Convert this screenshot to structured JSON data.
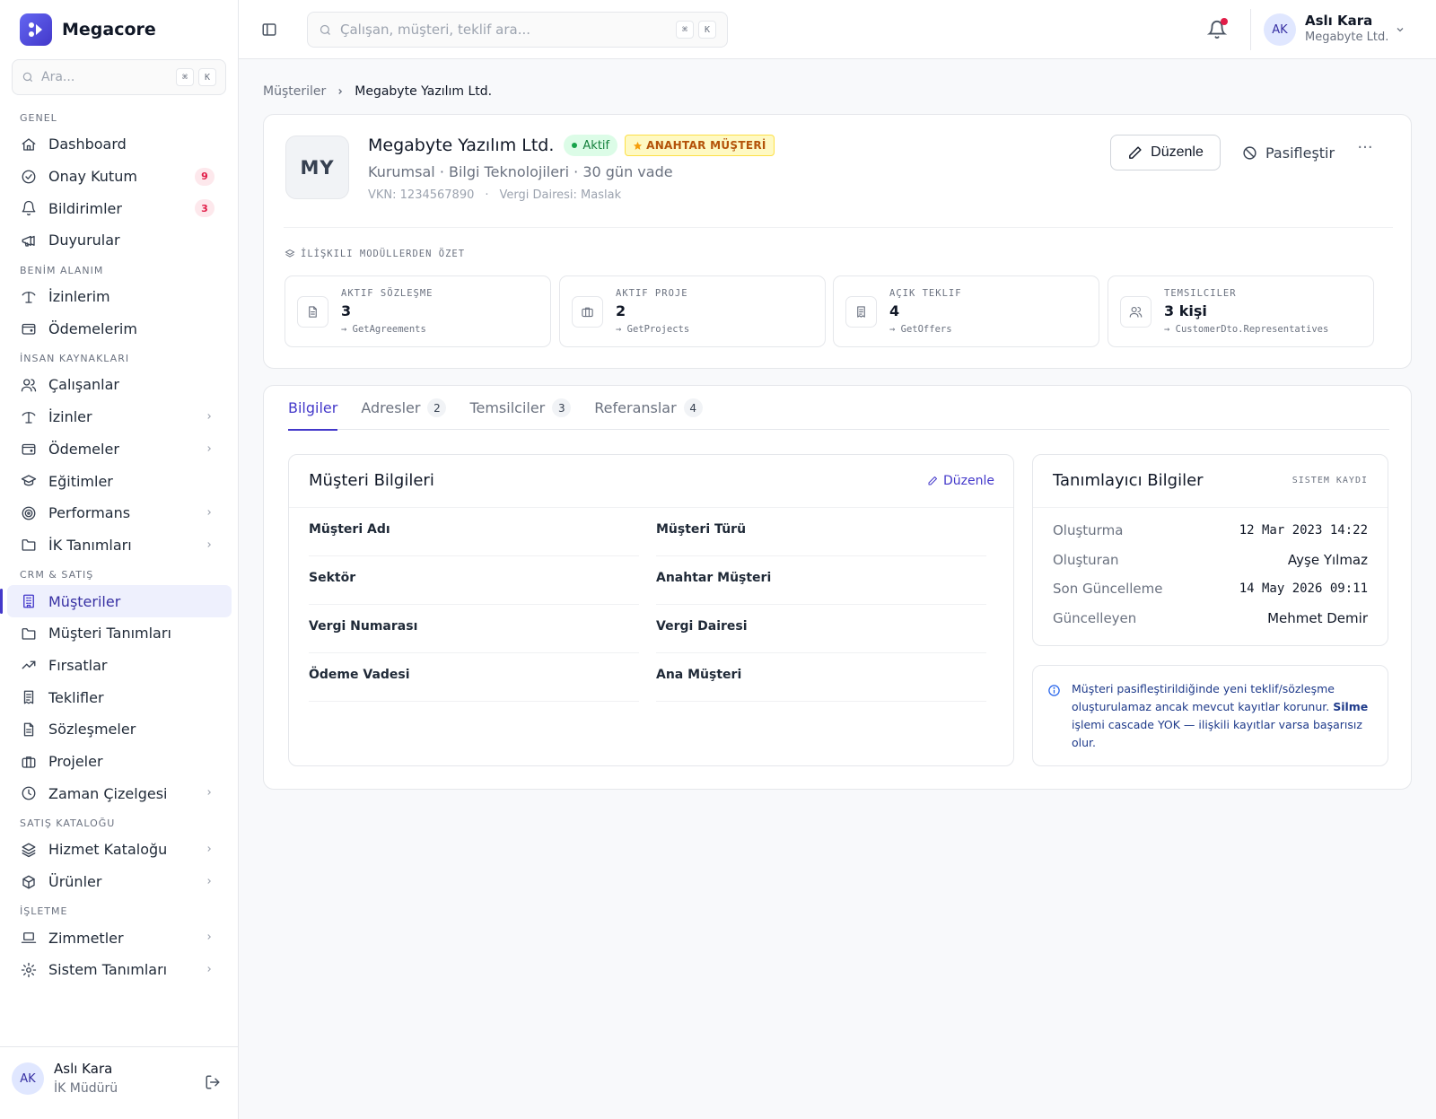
{
  "app": {
    "name": "Megacore"
  },
  "sidebar": {
    "search": {
      "placeholder": "Ara...",
      "kbd": [
        "⌘",
        "K"
      ]
    },
    "sections": [
      {
        "title": "GENEL",
        "items": [
          {
            "label": "Dashboard",
            "icon": "home-icon"
          },
          {
            "label": "Onay Kutum",
            "icon": "check-circle-icon",
            "badge": "9"
          },
          {
            "label": "Bildirimler",
            "icon": "bell-icon",
            "badge": "3"
          },
          {
            "label": "Duyurular",
            "icon": "megaphone-icon"
          }
        ]
      },
      {
        "title": "BENİM ALANIM",
        "items": [
          {
            "label": "İzinlerim",
            "icon": "umbrella-icon"
          },
          {
            "label": "Ödemelerim",
            "icon": "wallet-icon"
          }
        ]
      },
      {
        "title": "İNSAN KAYNAKLARI",
        "items": [
          {
            "label": "Çalışanlar",
            "icon": "users-icon"
          },
          {
            "label": "İzinler",
            "icon": "umbrella-icon",
            "chevron": true
          },
          {
            "label": "Ödemeler",
            "icon": "wallet-icon",
            "chevron": true
          },
          {
            "label": "Eğitimler",
            "icon": "graduation-cap-icon"
          },
          {
            "label": "Performans",
            "icon": "target-icon",
            "chevron": true
          },
          {
            "label": "İK Tanımları",
            "icon": "folder-icon",
            "chevron": true
          }
        ]
      },
      {
        "title": "CRM & SATIŞ",
        "items": [
          {
            "label": "Müşteriler",
            "icon": "building-icon",
            "active": true
          },
          {
            "label": "Müşteri Tanımları",
            "icon": "folder-icon"
          },
          {
            "label": "Fırsatlar",
            "icon": "trending-up-icon"
          },
          {
            "label": "Teklifler",
            "icon": "receipt-icon"
          },
          {
            "label": "Sözleşmeler",
            "icon": "file-text-icon"
          },
          {
            "label": "Projeler",
            "icon": "briefcase-icon"
          },
          {
            "label": "Zaman Çizelgesi",
            "icon": "clock-icon",
            "chevron": true
          }
        ]
      },
      {
        "title": "SATIŞ KATALOĞU",
        "items": [
          {
            "label": "Hizmet Kataloğu",
            "icon": "layers-icon",
            "chevron": true
          },
          {
            "label": "Ürünler",
            "icon": "package-icon",
            "chevron": true
          }
        ]
      },
      {
        "title": "İŞLETME",
        "items": [
          {
            "label": "Zimmetler",
            "icon": "laptop-icon",
            "chevron": true
          },
          {
            "label": "Sistem Tanımları",
            "icon": "gear-icon",
            "chevron": true
          }
        ]
      }
    ],
    "user": {
      "initials": "AK",
      "name": "Aslı Kara",
      "role": "İK Müdürü"
    }
  },
  "header": {
    "search": {
      "placeholder": "Çalışan, müşteri, teklif ara...",
      "kbd": [
        "⌘",
        "K"
      ]
    },
    "user": {
      "initials": "AK",
      "name": "Aslı Kara",
      "company": "Megabyte Ltd."
    },
    "colors": {
      "notification_dot": "#e11d48"
    }
  },
  "breadcrumb": {
    "parent": "Müşteriler",
    "current": "Megabyte Yazılım Ltd."
  },
  "customer": {
    "initials": "MY",
    "name": "Megabyte Yazılım Ltd.",
    "status": "Aktif",
    "key_badge": "ANAHTAR MÜŞTERİ",
    "subtitle": "Kurumsal · Bilgi Teknolojileri · 30 gün vade",
    "vkn": "VKN: 1234567890",
    "meta_sep": "·",
    "tax_office": "Vergi Dairesi: Maslak",
    "actions": {
      "edit": "Düzenle",
      "deactivate": "Pasifleştir",
      "more": "···"
    }
  },
  "summary": {
    "title": "İLİŞKILI MODÜLLERDEN ÖZET",
    "stats": [
      {
        "label": "AKTIF SÖZLEŞME",
        "value": "3",
        "source": "→ GetAgreements",
        "icon": "file-text-icon"
      },
      {
        "label": "AKTIF PROJE",
        "value": "2",
        "source": "→ GetProjects",
        "icon": "briefcase-icon"
      },
      {
        "label": "AÇIK TEKLIF",
        "value": "4",
        "source": "→ GetOffers",
        "icon": "receipt-icon"
      },
      {
        "label": "TEMSILCILER",
        "value": "3 kişi",
        "source": "→ CustomerDto.Representatives",
        "icon": "users-icon"
      }
    ]
  },
  "tabs": [
    {
      "label": "Bilgiler",
      "active": true
    },
    {
      "label": "Adresler",
      "count": "2"
    },
    {
      "label": "Temsilciler",
      "count": "3"
    },
    {
      "label": "Referanslar",
      "count": "4"
    }
  ],
  "info": {
    "title": "Müşteri Bilgileri",
    "edit": "Düzenle",
    "fields": [
      "Müşteri Adı",
      "Müşteri Türü",
      "Sektör",
      "Anahtar Müşteri",
      "Vergi Numarası",
      "Vergi Dairesi",
      "Ödeme Vadesi",
      "Ana Müşteri"
    ]
  },
  "identifier": {
    "title": "Tanımlayıcı Bilgiler",
    "tag": "SISTEM KAYDI",
    "rows": [
      {
        "key": "Oluşturma",
        "value": "12 Mar 2023 14:22"
      },
      {
        "key": "Oluşturan",
        "value": "Ayşe Yılmaz"
      },
      {
        "key": "Son Güncelleme",
        "value": "14 May 2026 09:11"
      },
      {
        "key": "Güncelleyen",
        "value": "Mehmet Demir"
      }
    ]
  },
  "note": {
    "text1": "Müşteri pasifleştirildiğinde yeni teklif/sözleşme oluşturulamaz ancak mevcut kayıtlar korunur.",
    "bold": "Silme",
    "text2": "işlemi cascade YOK — ilişkili kayıtlar varsa başarısız olur."
  }
}
